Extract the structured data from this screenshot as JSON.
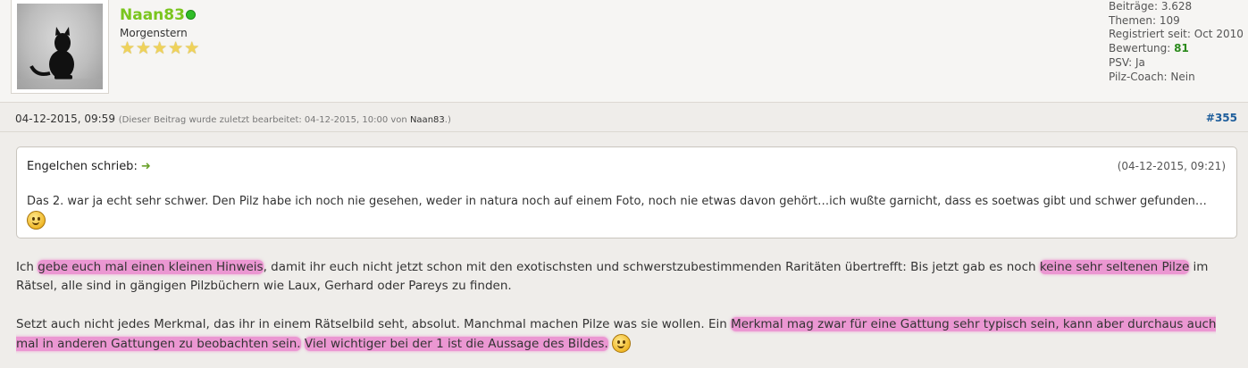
{
  "user": {
    "name": "Naan83",
    "rank": "Morgenstern",
    "star_count": 5,
    "online": true,
    "stats": {
      "posts_label": "Beiträge:",
      "posts": "3.628",
      "topics_label": "Themen:",
      "topics": "109",
      "registered_label": "Registriert seit:",
      "registered": "Oct 2010",
      "rating_label": "Bewertung:",
      "rating": "81",
      "psv_label": "PSV:",
      "psv": "Ja",
      "coach_label": "Pilz-Coach:",
      "coach": "Nein"
    }
  },
  "post": {
    "date": "04-12-2015, 09:59",
    "edit_note_prefix": "(Dieser Beitrag wurde zuletzt bearbeitet: 04-12-2015, 10:00 von ",
    "edit_note_by": "Naan83",
    "edit_note_suffix": ".)",
    "number": "#355"
  },
  "quote": {
    "author": "Engelchen schrieb:",
    "date": "(04-12-2015, 09:21)",
    "text": "Das 2. war ja echt sehr schwer. Den Pilz habe ich noch nie gesehen, weder in natura noch auf einem Foto, noch nie etwas davon gehört…ich wußte garnicht, dass es soetwas gibt und schwer gefunden…"
  },
  "paragraph1": {
    "p1": "Ich ",
    "h1": "gebe euch mal einen kleinen Hinweis",
    "p2": ", damit ihr euch nicht jetzt schon mit den exotischsten und schwerstzubestimmenden Raritäten übertrefft: Bis jetzt gab es noch ",
    "h2": "keine sehr seltenen Pilze",
    "p3": " im Rätsel, alle sind in gängigen Pilzbüchern wie Laux, Gerhard oder Pareys zu finden."
  },
  "paragraph2": {
    "p1": "Setzt auch nicht jedes Merkmal, das ihr in einem Rätselbild seht, absolut. Manchmal machen Pilze was sie wollen. Ein ",
    "h1": "Merkmal mag zwar für eine Gattung sehr typisch sein, kann aber durchaus auch mal in anderen Gattungen zu beobachten sein.",
    "p2": " ",
    "h2": "Viel wichtiger bei der 1 ist die Aussage des Bildes."
  },
  "colors": {
    "username": "#7ac51e",
    "highlight": "#e850be",
    "post_number": "#1d5d9b"
  }
}
